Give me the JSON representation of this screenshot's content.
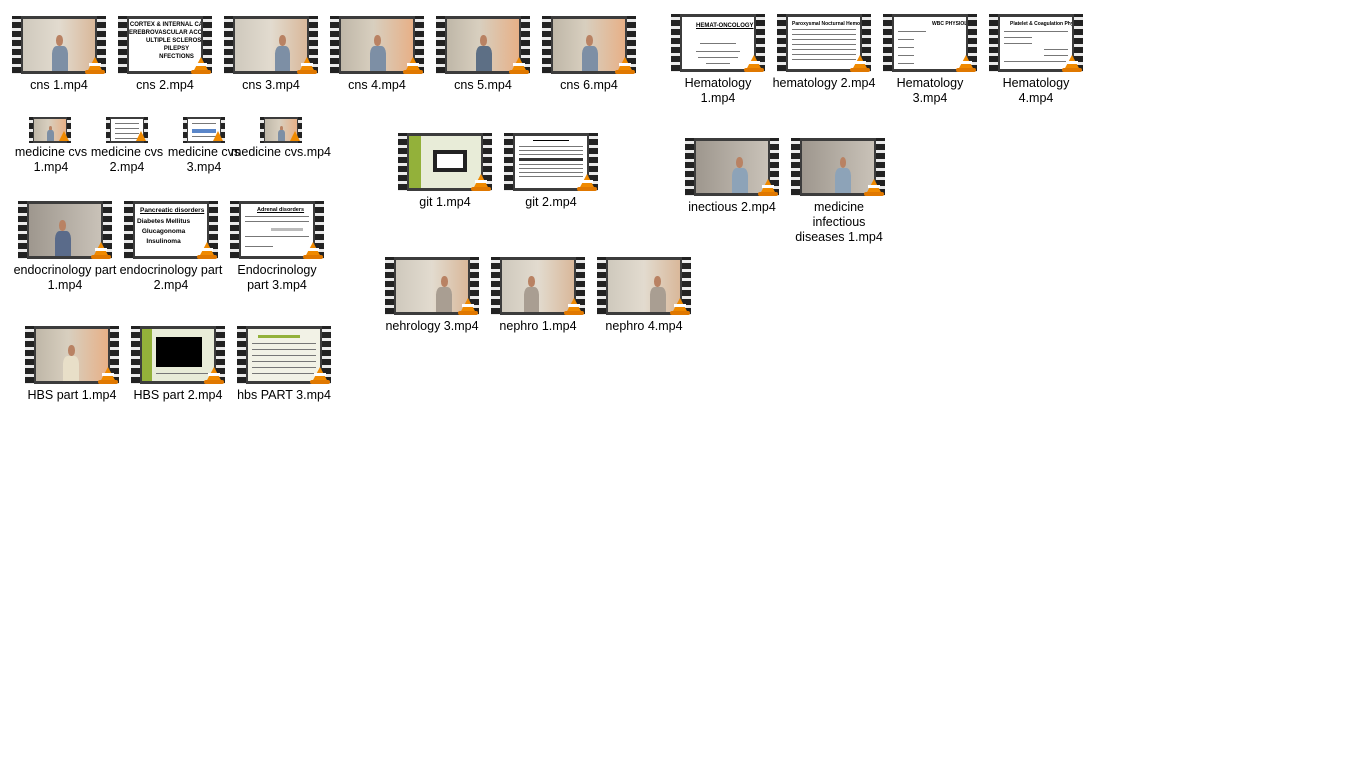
{
  "files": [
    {
      "name": "cns  1.mp4"
    },
    {
      "name": "cns 2.mp4",
      "thumb_text": [
        "CORTEX & INTERNAL CAPSULE",
        "EREBROVASCULAR ACCIDENTS",
        "ULTIPLE SCLEROSIS",
        "PILEPSY",
        "NFECTIONS"
      ]
    },
    {
      "name": "cns 3.mp4"
    },
    {
      "name": "cns 4.mp4"
    },
    {
      "name": "cns 5.mp4"
    },
    {
      "name": "cns 6.mp4"
    },
    {
      "name": "Hematology 1.mp4",
      "thumb_text": [
        "HEMAT-ONCOLOGY"
      ]
    },
    {
      "name": "hematology 2.mp4",
      "thumb_text": [
        "Paroxysmal Nocturnal Hemoglobinuria"
      ]
    },
    {
      "name": "Hematology 3.mp4",
      "thumb_text": [
        "WBC PHYSIOLO"
      ]
    },
    {
      "name": "Hematology 4.mp4",
      "thumb_text": [
        "Platelet & Coagulation Physiology"
      ]
    },
    {
      "name": "medicine cvs 1.mp4"
    },
    {
      "name": "medicine cvs 2.mp4"
    },
    {
      "name": "medicine cvs 3.mp4"
    },
    {
      "name": "medicine cvs.mp4"
    },
    {
      "name": "git 1.mp4"
    },
    {
      "name": "git 2.mp4"
    },
    {
      "name": "inectious 2.mp4"
    },
    {
      "name": "medicine infectious diseases 1.mp4"
    },
    {
      "name": "endocrinology part 1.mp4"
    },
    {
      "name": "endocrinology part 2.mp4",
      "thumb_text": [
        "Pancreatic disorders",
        "Diabetes Mellitus",
        "Glucagonoma",
        "Insulinoma"
      ]
    },
    {
      "name": "Endocrinology part 3.mp4",
      "thumb_text": [
        "Adrenal disorders"
      ]
    },
    {
      "name": "nehrology 3.mp4"
    },
    {
      "name": "nephro 1.mp4"
    },
    {
      "name": "nephro 4.mp4"
    },
    {
      "name": "HBS part 1.mp4"
    },
    {
      "name": "HBS part 2.mp4"
    },
    {
      "name": "hbs PART 3.mp4"
    }
  ],
  "icons": {
    "vlc": "vlc-cone-icon",
    "film": "film-strip"
  }
}
